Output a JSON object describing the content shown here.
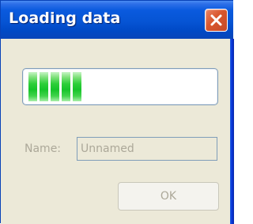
{
  "window": {
    "title": "Loading data",
    "close_icon": "close-icon"
  },
  "progress": {
    "filled_blocks": 5,
    "fill_fraction": 0.3,
    "color": "#16c42a"
  },
  "form": {
    "name_label": "Name:",
    "name_value": "Unnamed",
    "name_enabled": false
  },
  "buttons": {
    "ok_label": "OK",
    "ok_enabled": false
  },
  "colors": {
    "titlebar": "#0654d4",
    "client": "#ece9d8",
    "disabled_text": "#aca899",
    "close_button": "#d9562d"
  }
}
